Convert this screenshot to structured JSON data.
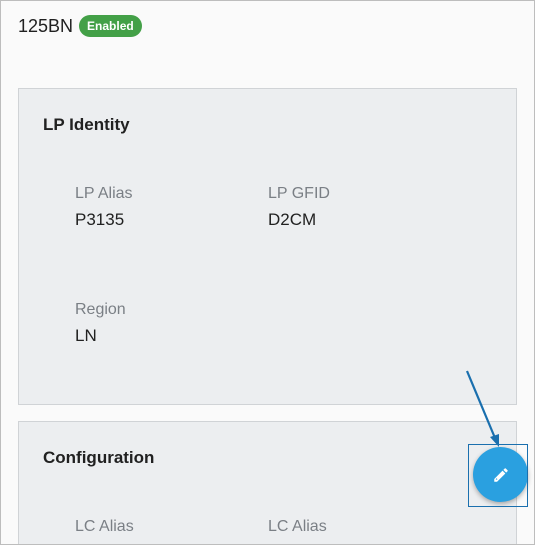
{
  "header": {
    "title": "125BN",
    "status_badge": "Enabled"
  },
  "lp_identity": {
    "title": "LP Identity",
    "fields": [
      {
        "label": "LP Alias",
        "value": "P3135"
      },
      {
        "label": "LP GFID",
        "value": "D2CM"
      },
      {
        "label": "Region",
        "value": "LN"
      }
    ]
  },
  "configuration": {
    "title": "Configuration",
    "fields": [
      {
        "label": "LC Alias"
      },
      {
        "label": "LC Alias"
      }
    ]
  },
  "fab": {
    "icon": "pencil-icon"
  },
  "colors": {
    "badge": "#43a047",
    "fab": "#2aa0e0",
    "annotation": "#1a6fae"
  }
}
